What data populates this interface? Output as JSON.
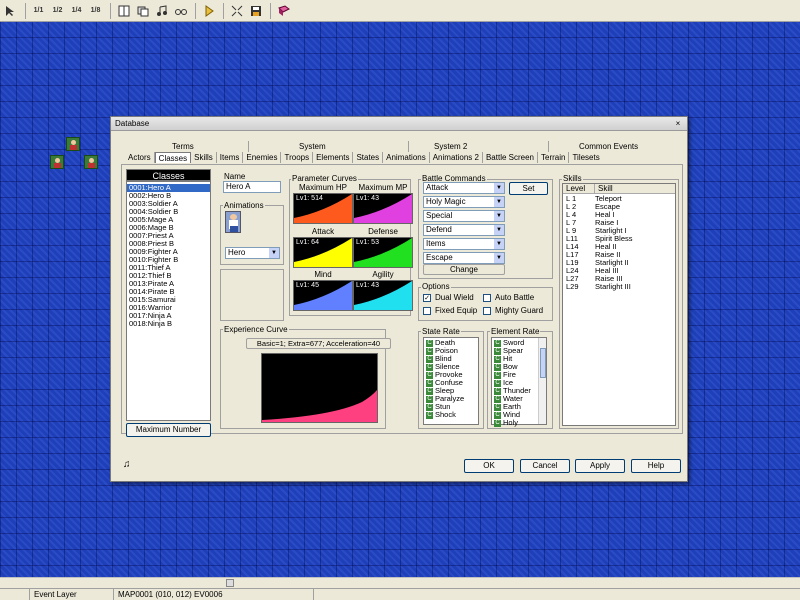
{
  "toolbar": {
    "buttons": [
      {
        "name": "zoom-1-1-button",
        "label": "1/1"
      },
      {
        "name": "zoom-1-2-button",
        "label": "1/2"
      },
      {
        "name": "zoom-1-4-button",
        "label": "1/4"
      },
      {
        "name": "zoom-1-8-button",
        "label": "1/8"
      }
    ]
  },
  "dialog": {
    "title": "Database",
    "close_glyph": "×",
    "tabs_top": [
      "Terms",
      "System",
      "System 2",
      "Common Events"
    ],
    "tabs_bottom": [
      "Actors",
      "Classes",
      "Skills",
      "Items",
      "Enemies",
      "Troops",
      "Elements",
      "States",
      "Animations",
      "Animations 2",
      "Battle Screen",
      "Terrain",
      "Tilesets"
    ],
    "active_tab": "Classes",
    "classes_header": "Classes",
    "classes": [
      "0001:Hero A",
      "0002:Hero B",
      "0003:Soldier A",
      "0004:Soldier B",
      "0005:Mage A",
      "0006:Mage B",
      "0007:Priest A",
      "0008:Priest B",
      "0009:Fighter A",
      "0010:Fighter B",
      "0011:Thief A",
      "0012:Thief B",
      "0013:Pirate A",
      "0014:Pirate B",
      "0015:Samurai",
      "0016:Warrior",
      "0017:Ninja A",
      "0018:Ninja B"
    ],
    "max_number_button": "Maximum Number",
    "name_label": "Name",
    "name_value": "Hero A",
    "animations_label": "Animations",
    "animation_value": "Hero",
    "param_curves_label": "Parameter Curves",
    "curves": [
      {
        "title": "Maximum HP",
        "value": "Lv1: 514",
        "color": "#ff5a1e"
      },
      {
        "title": "Maximum MP",
        "value": "Lv1: 43",
        "color": "#e040e0"
      },
      {
        "title": "Attack",
        "value": "Lv1: 64",
        "color": "#ffff00"
      },
      {
        "title": "Defense",
        "value": "Lv1: 53",
        "color": "#20e020"
      },
      {
        "title": "Mind",
        "value": "Lv1: 45",
        "color": "#6080ff"
      },
      {
        "title": "Agility",
        "value": "Lv1: 43",
        "color": "#20e0f0"
      }
    ],
    "exp_curve_label": "Experience Curve",
    "exp_curve_params": "Basic=1; Extra=677; Acceleration=40",
    "exp_curve_color": "#ff4080",
    "battle_commands_label": "Battle Commands",
    "battle_commands": [
      "Attack",
      "Holy Magic",
      "Special",
      "Defend",
      "Items",
      "Escape"
    ],
    "set_button": "Set",
    "change_button": "Change",
    "options_label": "Options",
    "options": [
      {
        "label": "Dual Wield",
        "checked": "✓"
      },
      {
        "label": "Auto Battle",
        "checked": ""
      },
      {
        "label": "Fixed Equip",
        "checked": ""
      },
      {
        "label": "Mighty Guard",
        "checked": ""
      }
    ],
    "state_rate_label": "State Rate",
    "state_badge": "C",
    "states": [
      "Death",
      "Poison",
      "Blind",
      "Silence",
      "Provoke",
      "Confuse",
      "Sleep",
      "Paralyze",
      "Stun",
      "Shock"
    ],
    "element_rate_label": "Element Rate",
    "elements": [
      "Sword",
      "Spear",
      "Hit",
      "Bow",
      "Fire",
      "Ice",
      "Thunder",
      "Water",
      "Earth",
      "Wind",
      "Holy"
    ],
    "skills_label": "Skills",
    "skills_header": {
      "level": "Level",
      "skill": "Skill"
    },
    "skills": [
      {
        "level": "L 1",
        "skill": "Teleport"
      },
      {
        "level": "L 2",
        "skill": "Escape"
      },
      {
        "level": "L 4",
        "skill": "Heal I"
      },
      {
        "level": "L 7",
        "skill": "Raise I"
      },
      {
        "level": "L 9",
        "skill": "Starlight I"
      },
      {
        "level": "L11",
        "skill": "Spirit Bless"
      },
      {
        "level": "L14",
        "skill": "Heal II"
      },
      {
        "level": "L17",
        "skill": "Raise II"
      },
      {
        "level": "L19",
        "skill": "Starlight II"
      },
      {
        "level": "L24",
        "skill": "Heal III"
      },
      {
        "level": "L27",
        "skill": "Raise III"
      },
      {
        "level": "L29",
        "skill": "Starlight III"
      }
    ],
    "ok_button": "OK",
    "cancel_button": "Cancel",
    "apply_button": "Apply",
    "help_button": "Help"
  },
  "statusbar": {
    "layer": "Event Layer",
    "position": "MAP0001 (010, 012) EV0006"
  }
}
